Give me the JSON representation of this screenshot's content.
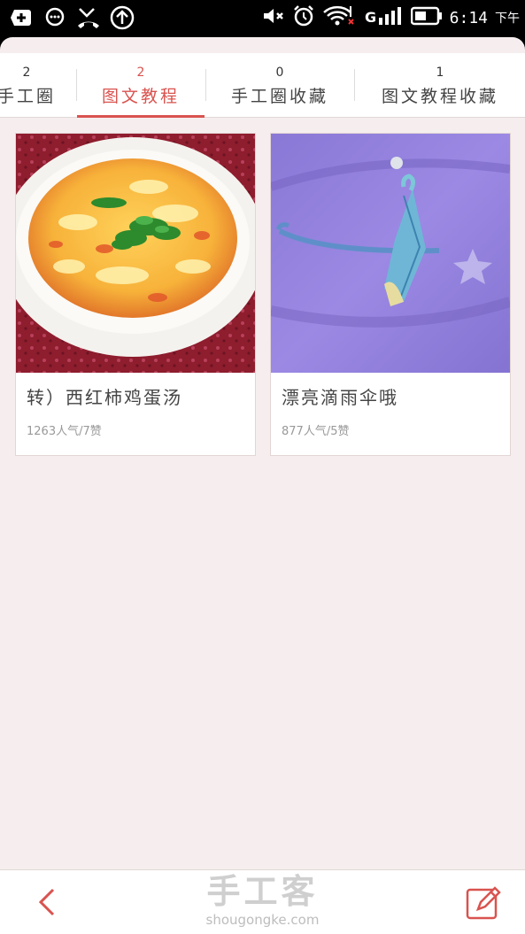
{
  "status_bar": {
    "time": "6:14",
    "ampm": "下午",
    "left_icons": [
      "add-box-icon",
      "chat-bubble-icon",
      "missed-call-icon",
      "upload-arrow-icon"
    ],
    "right_icons": [
      "volume-mute-icon",
      "alarm-icon",
      "wifi-icon",
      "signal-icon",
      "battery-icon"
    ]
  },
  "tabs": [
    {
      "count": "2",
      "label": "手工圈",
      "active": false
    },
    {
      "count": "2",
      "label": "图文教程",
      "active": true
    },
    {
      "count": "0",
      "label": "手工圈收藏",
      "active": false
    },
    {
      "count": "1",
      "label": "图文教程收藏",
      "active": false
    }
  ],
  "cards": [
    {
      "title": "转）西红柿鸡蛋汤",
      "meta": "1263人气/7赞",
      "image": "tomato-egg-soup-photo"
    },
    {
      "title": "漂亮滴雨伞哦",
      "meta": "877人气/5赞",
      "image": "origami-umbrella-photo"
    }
  ],
  "bottom_bar": {
    "brand_cn": "手工客",
    "brand_url": "shougongke.com",
    "back_icon": "chevron-left-icon",
    "edit_icon": "edit-icon"
  },
  "colors": {
    "accent": "#d9534f",
    "background": "#f6eeee"
  }
}
